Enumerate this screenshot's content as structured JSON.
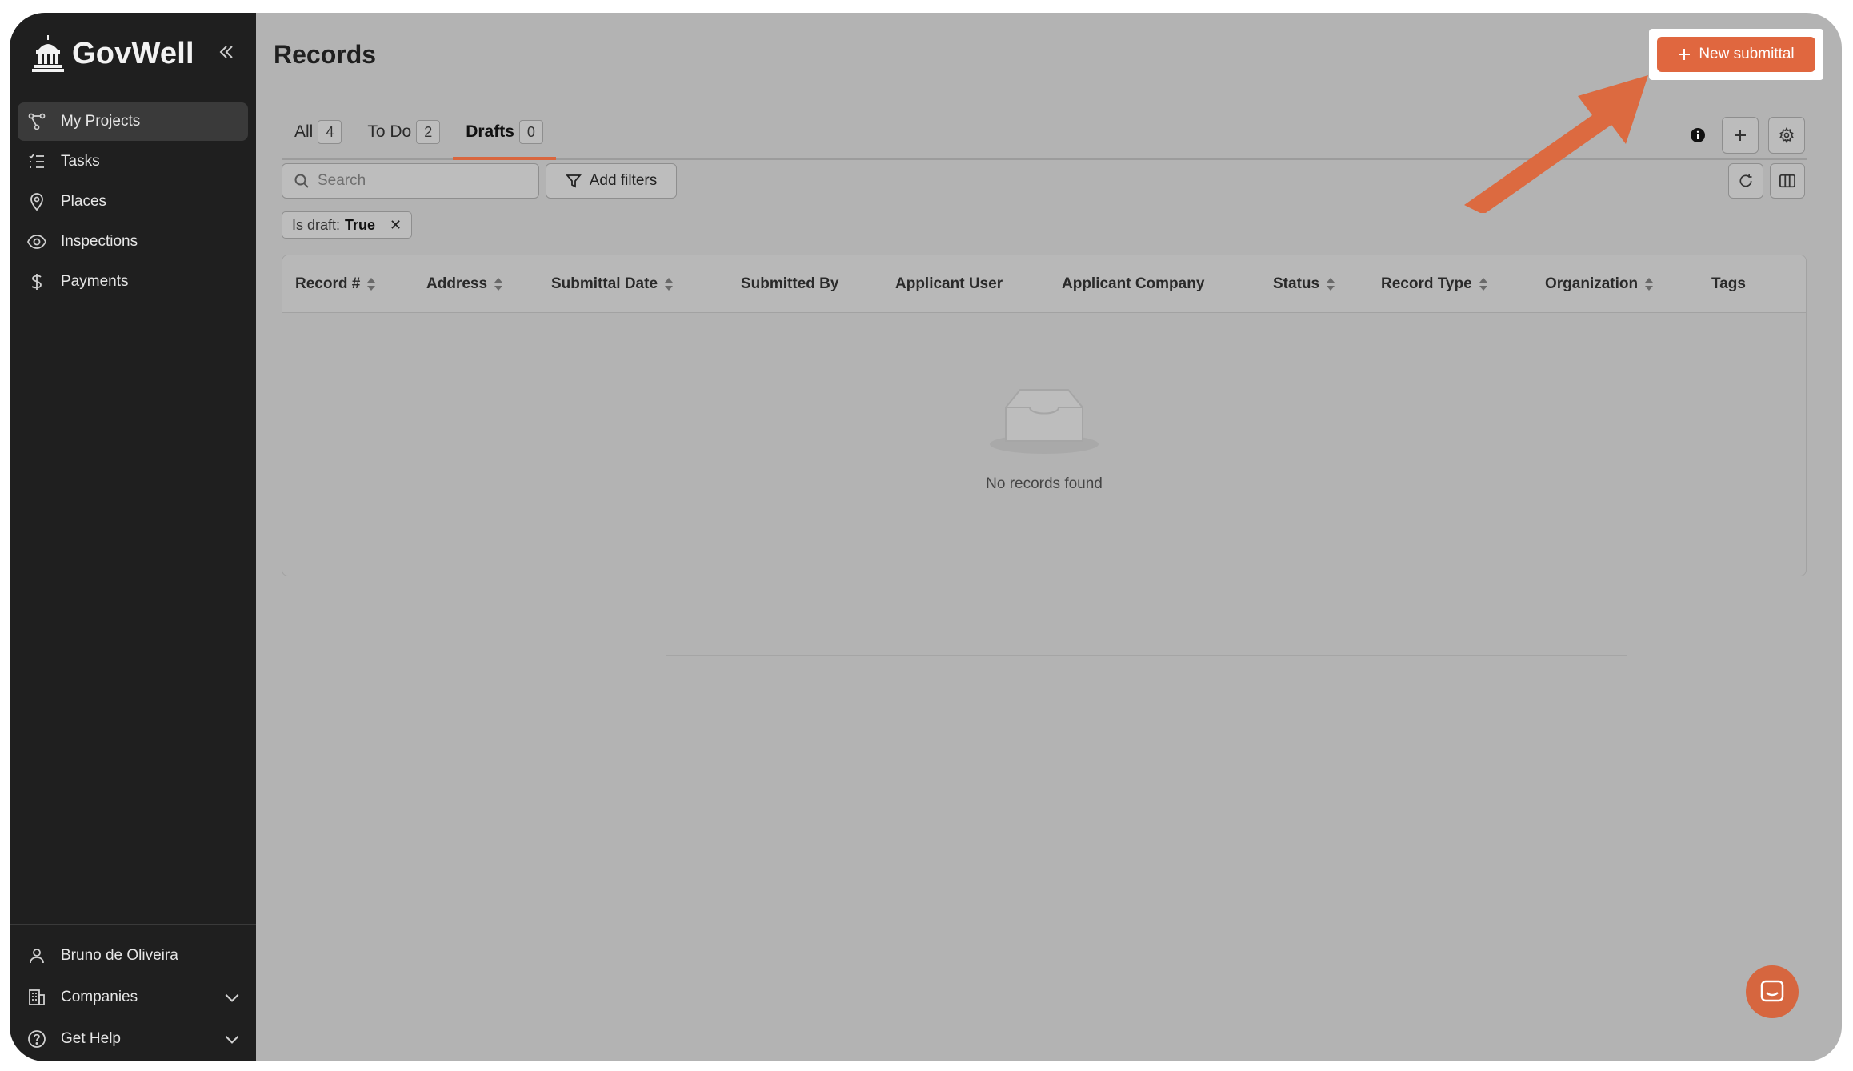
{
  "app": {
    "name": "GovWell"
  },
  "sidebar": {
    "items": [
      {
        "label": "My Projects",
        "icon": "projects-icon",
        "active": true
      },
      {
        "label": "Tasks",
        "icon": "tasks-icon"
      },
      {
        "label": "Places",
        "icon": "map-pin-icon"
      },
      {
        "label": "Inspections",
        "icon": "eye-icon"
      },
      {
        "label": "Payments",
        "icon": "dollar-icon"
      }
    ],
    "bottom": [
      {
        "label": "Bruno de Oliveira",
        "icon": "user-icon"
      },
      {
        "label": "Companies",
        "icon": "building-icon",
        "expandable": true
      },
      {
        "label": "Get Help",
        "icon": "help-icon",
        "expandable": true
      }
    ]
  },
  "main": {
    "title": "Records",
    "new_button_label": "New submittal",
    "tabs": [
      {
        "label": "All",
        "count": "4"
      },
      {
        "label": "To Do",
        "count": "2"
      },
      {
        "label": "Drafts",
        "count": "0",
        "active": true
      }
    ],
    "search": {
      "placeholder": "Search",
      "value": ""
    },
    "filters_label": "Add filters",
    "active_filter": {
      "key": "Is draft:",
      "value": "True"
    },
    "table": {
      "columns": [
        {
          "label": "Record #",
          "sortable": true
        },
        {
          "label": "Address",
          "sortable": true
        },
        {
          "label": "Submittal Date",
          "sortable": true
        },
        {
          "label": "Submitted By",
          "sortable": false
        },
        {
          "label": "Applicant User",
          "sortable": false
        },
        {
          "label": "Applicant Company",
          "sortable": false
        },
        {
          "label": "Status",
          "sortable": true
        },
        {
          "label": "Record Type",
          "sortable": true
        },
        {
          "label": "Organization",
          "sortable": true
        },
        {
          "label": "Tags",
          "sortable": false
        }
      ],
      "rows": [],
      "empty_text": "No records found"
    }
  },
  "colors": {
    "accent": "#e0673f",
    "sidebar_bg": "#1f1f1f",
    "overlay_bg": "#b3b3b3"
  }
}
